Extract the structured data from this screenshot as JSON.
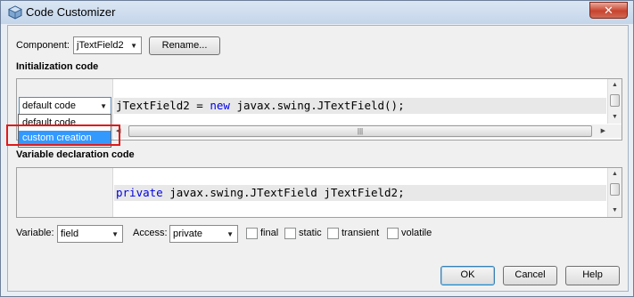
{
  "window": {
    "title": "Code Customizer",
    "close_glyph": "✕"
  },
  "component": {
    "label": "Component:",
    "value": "jTextField2",
    "rename_label": "Rename..."
  },
  "init_section": {
    "heading": "Initialization code",
    "mode_value": "default code",
    "code": {
      "var": "jTextField2 = ",
      "kw": "new",
      "rest": " javax.swing.JTextField();"
    },
    "options": [
      "default code",
      "custom creation"
    ],
    "hscroll_grip": "|||"
  },
  "var_section": {
    "heading": "Variable declaration code",
    "code": {
      "kw": "private",
      "rest": " javax.swing.JTextField jTextField2;"
    }
  },
  "bottom_row": {
    "variable_label": "Variable:",
    "variable_value": "field",
    "access_label": "Access:",
    "access_value": "private",
    "modifiers": [
      "final",
      "static",
      "transient",
      "volatile"
    ]
  },
  "buttons": {
    "ok": "OK",
    "cancel": "Cancel",
    "help": "Help"
  },
  "icons": {
    "title": "cube-icon",
    "dropdown_arrow": "chevron-down-icon",
    "scroll_up": "arrow-up-icon",
    "scroll_down": "arrow-down-icon"
  },
  "colors": {
    "selection": "#3399ff",
    "keyword": "#0000e6",
    "highlight_box": "#e01a1a"
  }
}
